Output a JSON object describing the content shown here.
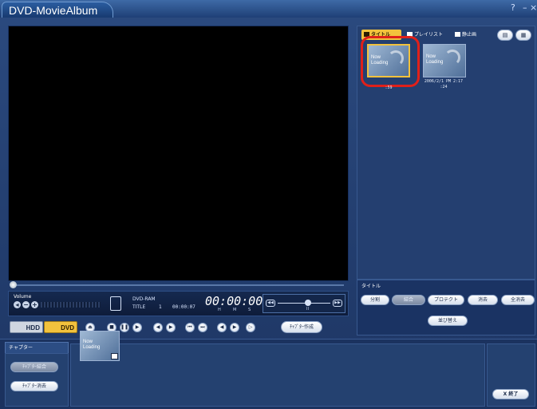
{
  "app": {
    "title": "DVD-MovieAlbum",
    "help": "?",
    "minimize": "–",
    "close": "×"
  },
  "player": {
    "volume_label": "Volume",
    "media": "DVD-RAM",
    "title_label": "TITLE",
    "title_number": "1",
    "small_time": "00:00:07",
    "big_time": "00:00:00",
    "hms": [
      "H",
      "M",
      "S"
    ],
    "speed_tick": "II"
  },
  "transport": {
    "hdd_label": "HDD",
    "dvd_label": "DVD",
    "chapter_make_label": "ﾁｬﾌﾟﾀｰ作成"
  },
  "panel": {
    "tabs": [
      "タイトル",
      "プレイリスト",
      "静止画"
    ],
    "active_tab": 0,
    "thumbnails": [
      {
        "text": "Now\nLoading",
        "caption_line1": "",
        "caption_line2": ":59",
        "selected": true
      },
      {
        "text": "Now\nLoading",
        "caption_line1": "2006/2/1 PM 2:17",
        "caption_line2": ":24",
        "selected": false
      }
    ]
  },
  "title_actions": {
    "section_label": "タイトル",
    "buttons": [
      {
        "label": "分割",
        "enabled": true
      },
      {
        "label": "結合",
        "enabled": false
      },
      {
        "label": "プロテクト",
        "enabled": true
      },
      {
        "label": "消去",
        "enabled": true
      },
      {
        "label": "全消去",
        "enabled": true
      },
      {
        "label": "並び替え",
        "enabled": true
      }
    ]
  },
  "chapter": {
    "tab_label": "チャプター",
    "thumb_text": "Now\nLoading",
    "btn_disabled": "ﾁｬﾌﾟﾀｰ結合",
    "btn_delete": "ﾁｬﾌﾟﾀｰ消去",
    "exit_label": "終了",
    "exit_icon": "X"
  },
  "colors": {
    "accent": "#f2c23d",
    "highlight": "#e0201a",
    "bg": "#243f70"
  }
}
